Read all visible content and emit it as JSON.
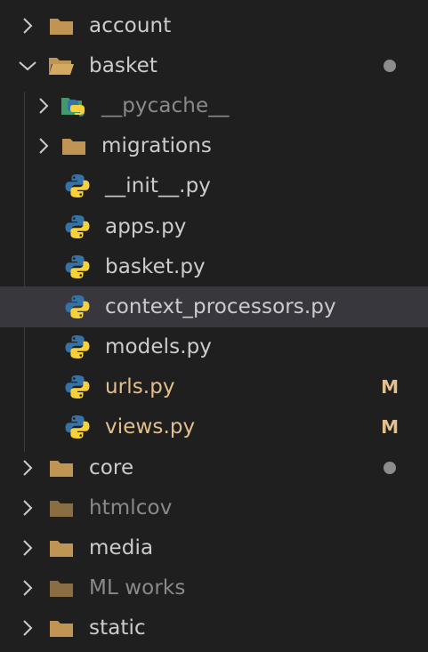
{
  "explorer": {
    "items": [
      {
        "label": "account"
      },
      {
        "label": "basket"
      },
      {
        "label": "__pycache__"
      },
      {
        "label": "migrations"
      },
      {
        "label": "__init__.py"
      },
      {
        "label": "apps.py"
      },
      {
        "label": "basket.py"
      },
      {
        "label": "context_processors.py"
      },
      {
        "label": "models.py"
      },
      {
        "label": "urls.py",
        "badge": "M"
      },
      {
        "label": "views.py",
        "badge": "M"
      },
      {
        "label": "core"
      },
      {
        "label": "htmlcov"
      },
      {
        "label": "media"
      },
      {
        "label": "ML works"
      },
      {
        "label": "static"
      }
    ]
  },
  "colors": {
    "background": "#1f1f1f",
    "selected_row": "#37373d",
    "folder": "#c09553",
    "modified": "#e2c08d",
    "dimmed_text": "#8a8a8a",
    "python_blue": "#3572a5",
    "python_yellow": "#f7d13b"
  },
  "icons": {
    "collapsed": "chevron-right-icon",
    "expanded": "chevron-down-icon",
    "folder": "folder-icon",
    "open_folder": "folder-open-icon",
    "python_file": "python-icon",
    "pycache_folder": "python-cache-folder-icon"
  }
}
